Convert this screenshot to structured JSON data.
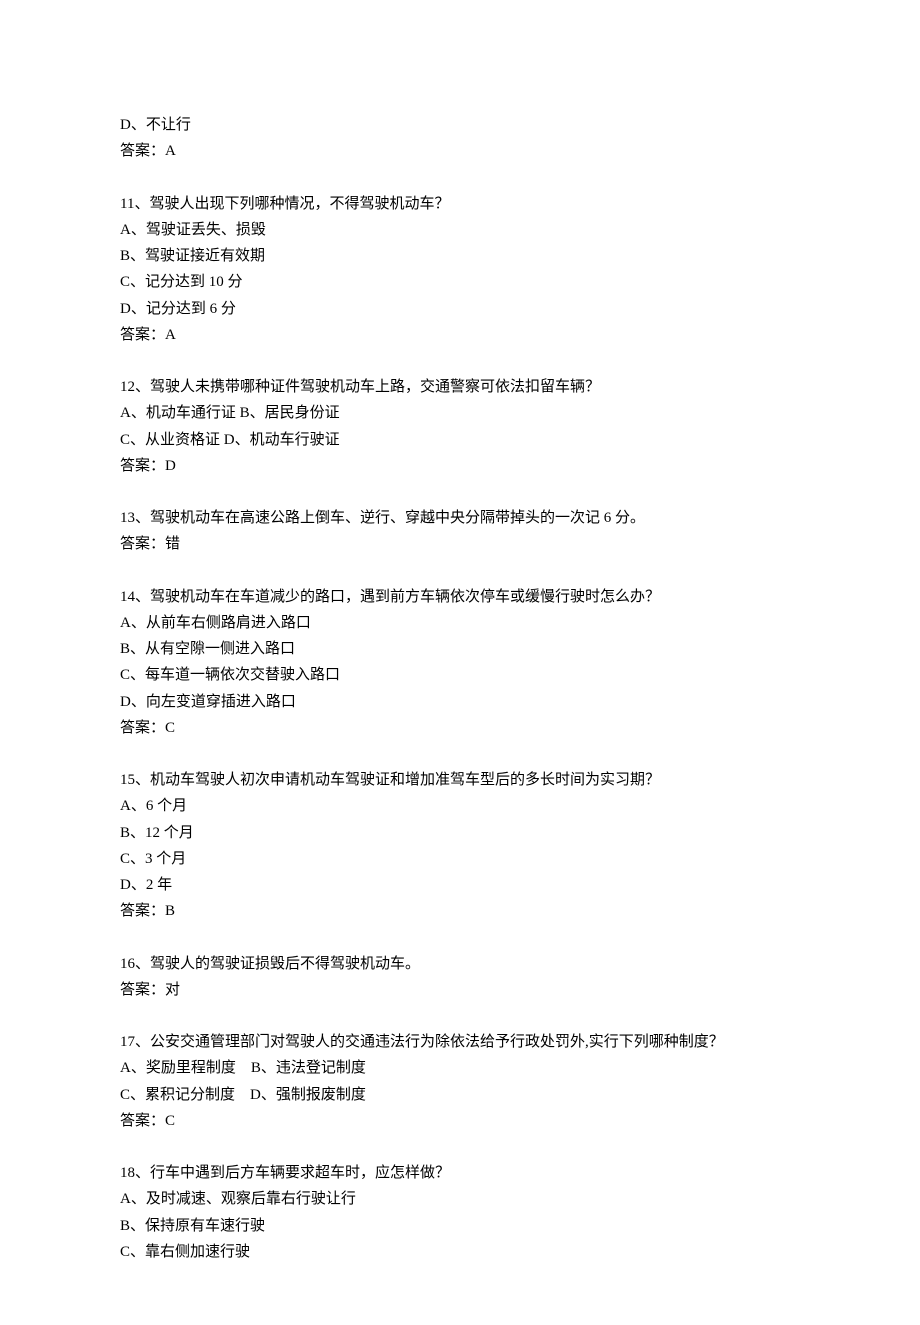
{
  "blocks": [
    {
      "lines": [
        "D、不让行",
        "答案：A"
      ]
    },
    {
      "lines": [
        "11、驾驶人出现下列哪种情况，不得驾驶机动车？",
        "A、驾驶证丢失、损毁",
        "B、驾驶证接近有效期",
        "C、记分达到 10 分",
        "D、记分达到 6 分",
        "答案：A"
      ]
    },
    {
      "lines": [
        "12、驾驶人未携带哪种证件驾驶机动车上路，交通警察可依法扣留车辆？",
        "A、机动车通行证 B、居民身份证",
        "C、从业资格证 D、机动车行驶证",
        "答案：D"
      ]
    },
    {
      "lines": [
        "13、驾驶机动车在高速公路上倒车、逆行、穿越中央分隔带掉头的一次记 6 分。",
        "答案：错"
      ]
    },
    {
      "lines": [
        "14、驾驶机动车在车道减少的路口，遇到前方车辆依次停车或缓慢行驶时怎么办？",
        "A、从前车右侧路肩进入路口",
        "B、从有空隙一侧进入路口",
        "C、每车道一辆依次交替驶入路口",
        "D、向左变道穿插进入路口",
        "答案：C"
      ]
    },
    {
      "lines": [
        "15、机动车驾驶人初次申请机动车驾驶证和增加准驾车型后的多长时间为实习期？",
        "A、6 个月",
        "B、12 个月",
        "C、3 个月",
        "D、2 年",
        "答案：B"
      ]
    },
    {
      "lines": [
        "16、驾驶人的驾驶证损毁后不得驾驶机动车。",
        "答案：对"
      ]
    },
    {
      "lines": [
        "17、公安交通管理部门对驾驶人的交通违法行为除依法给予行政处罚外,实行下列哪种制度？",
        "A、奖励里程制度    B、违法登记制度",
        "C、累积记分制度    D、强制报废制度",
        "答案：C"
      ]
    },
    {
      "lines": [
        "18、行车中遇到后方车辆要求超车时，应怎样做？",
        "A、及时减速、观察后靠右行驶让行",
        "B、保持原有车速行驶",
        "C、靠右侧加速行驶"
      ]
    }
  ]
}
